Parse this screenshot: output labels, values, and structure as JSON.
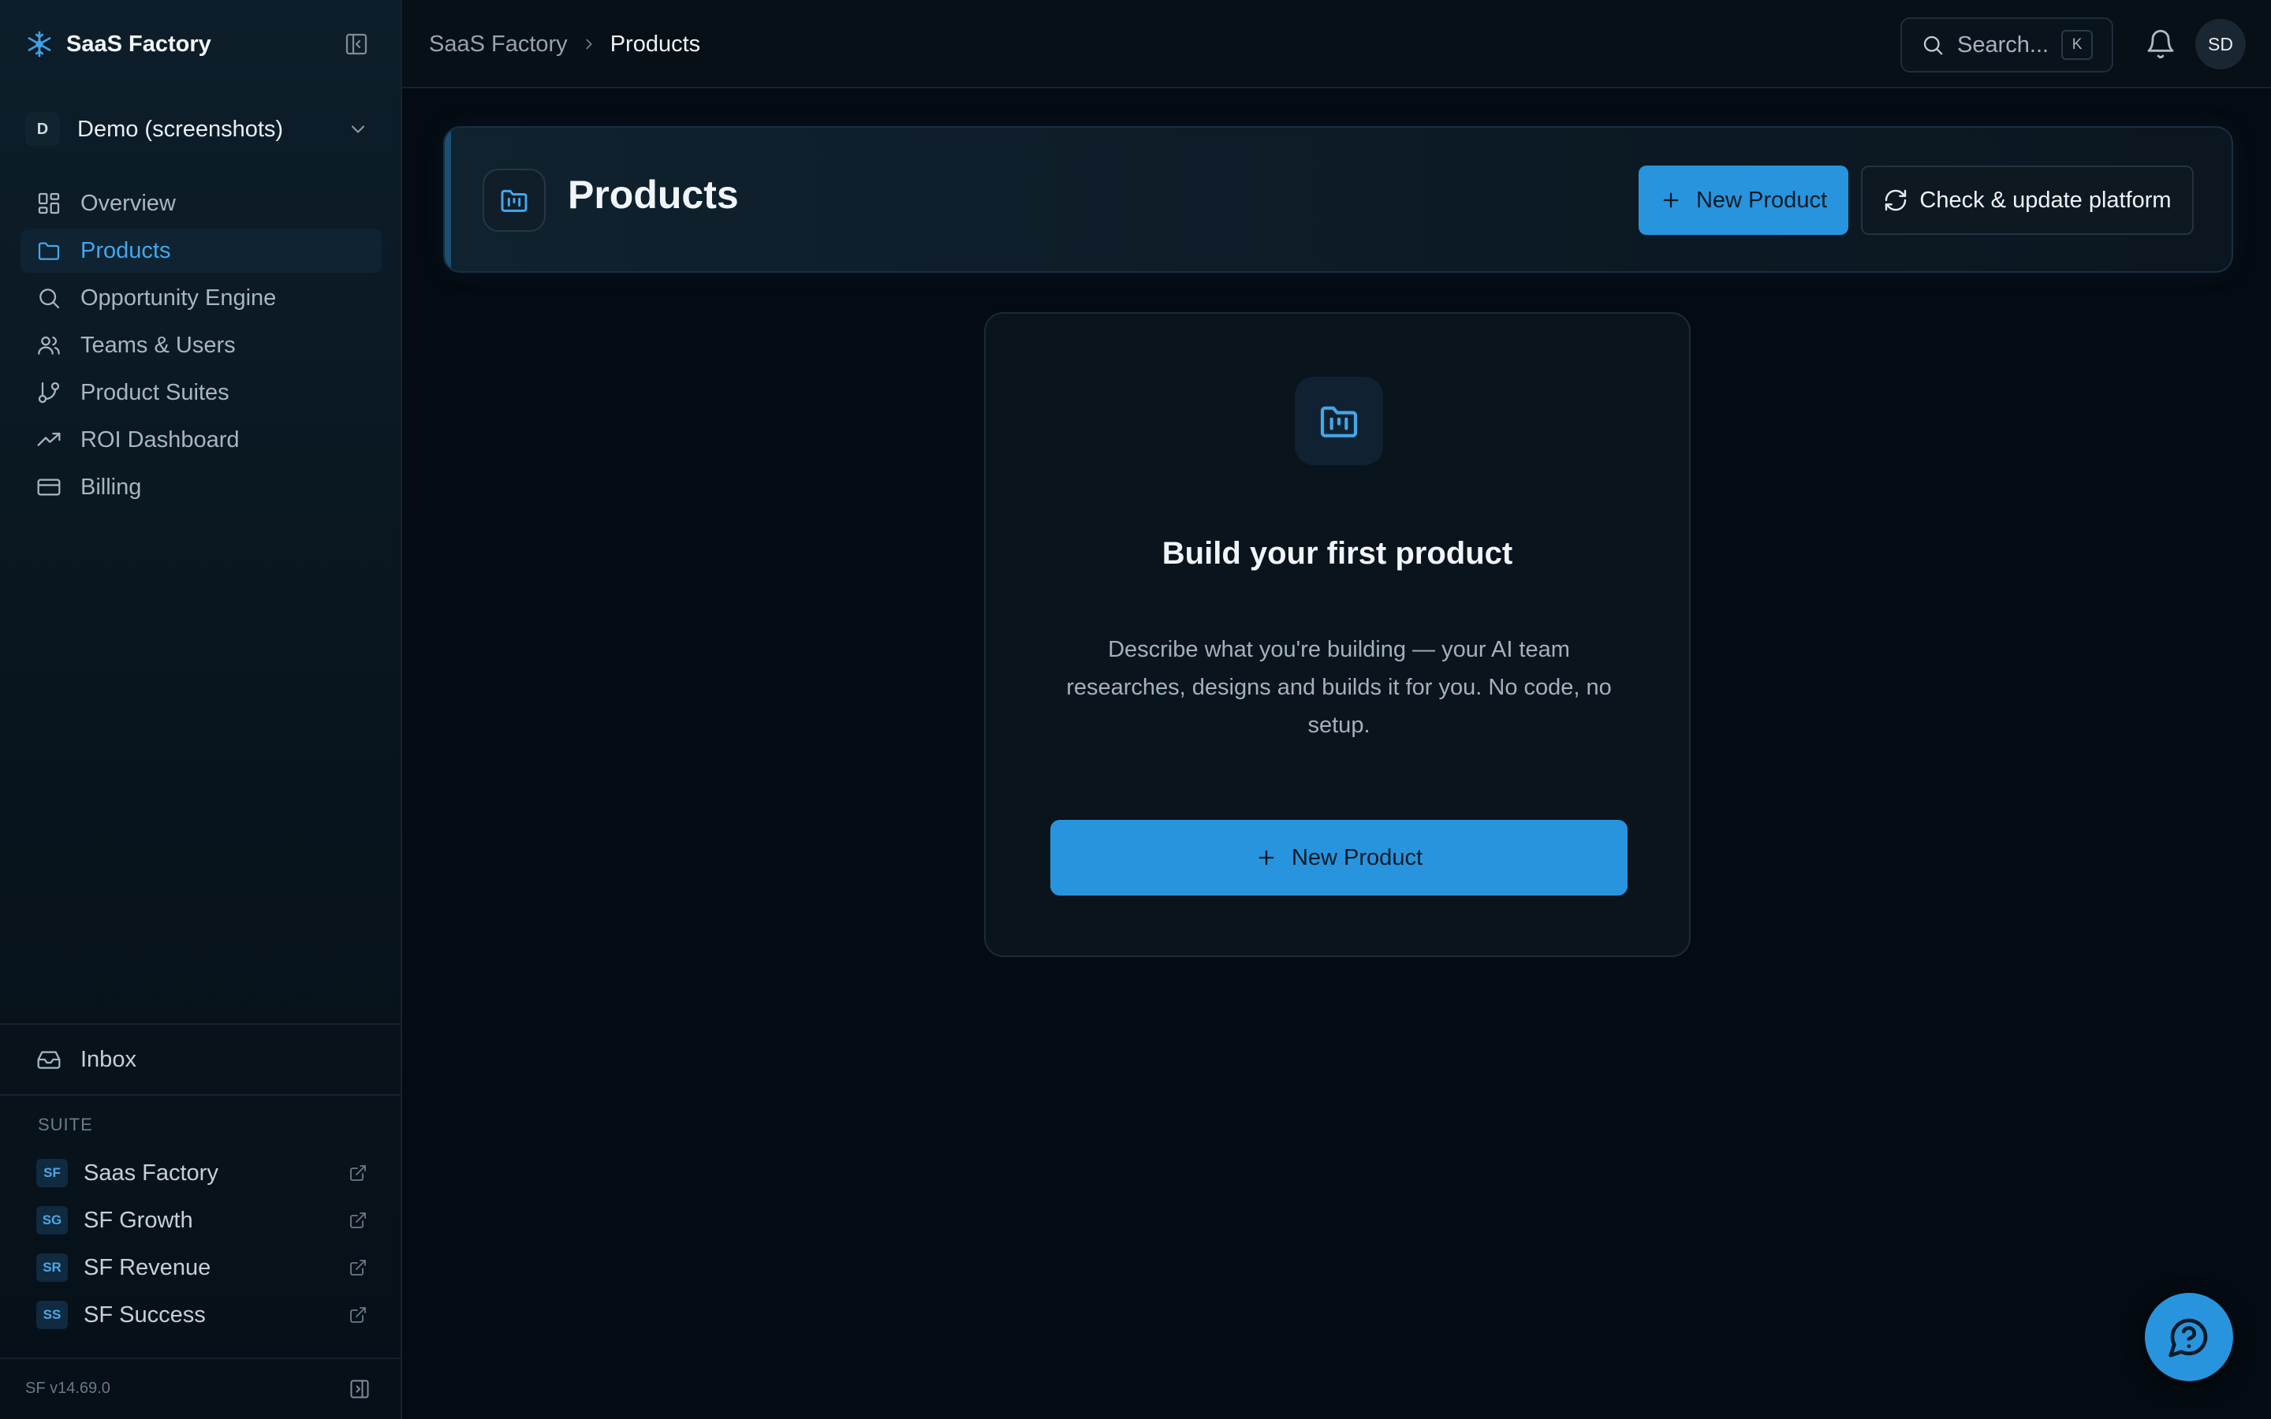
{
  "brand": {
    "name": "SaaS Factory"
  },
  "workspace": {
    "badge": "D",
    "name": "Demo (screenshots)"
  },
  "nav": [
    {
      "label": "Overview",
      "icon": "layout-grid-icon",
      "active": false
    },
    {
      "label": "Products",
      "icon": "folder-icon",
      "active": true
    },
    {
      "label": "Opportunity Engine",
      "icon": "search-icon",
      "active": false
    },
    {
      "label": "Teams & Users",
      "icon": "users-icon",
      "active": false
    },
    {
      "label": "Product Suites",
      "icon": "git-branch-icon",
      "active": false
    },
    {
      "label": "ROI Dashboard",
      "icon": "trending-up-icon",
      "active": false
    },
    {
      "label": "Billing",
      "icon": "credit-card-icon",
      "active": false
    }
  ],
  "inbox": {
    "label": "Inbox"
  },
  "suite": {
    "label": "SUITE",
    "items": [
      {
        "badge": "SF",
        "name": "Saas Factory"
      },
      {
        "badge": "SG",
        "name": "SF Growth"
      },
      {
        "badge": "SR",
        "name": "SF Revenue"
      },
      {
        "badge": "SS",
        "name": "SF Success"
      }
    ]
  },
  "version": "SF v14.69.0",
  "breadcrumb": {
    "root": "SaaS Factory",
    "current": "Products"
  },
  "search": {
    "placeholder": "Search...",
    "shortcut": "K"
  },
  "user": {
    "initials": "SD"
  },
  "page": {
    "title": "Products",
    "new_product_label": "New Product",
    "check_update_label": "Check & update platform"
  },
  "empty_state": {
    "title": "Build your first product",
    "description": "Describe what you're building — your AI team researches, designs and builds it for you. No code, no setup.",
    "button_label": "New Product"
  },
  "colors": {
    "accent": "#2894dd",
    "active_nav": "#45a6ea",
    "background": "#050b12",
    "sidebar": "#0d1e2a"
  }
}
